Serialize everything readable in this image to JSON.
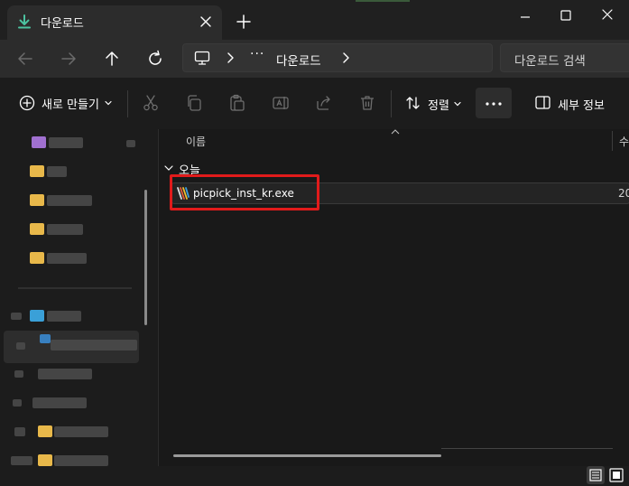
{
  "tab": {
    "title": "다운로드",
    "icon": "download-icon"
  },
  "address": {
    "overflow": "···",
    "current": "다운로드"
  },
  "search": {
    "placeholder": "다운로드 검색"
  },
  "toolbar": {
    "new_label": "새로 만들기",
    "sort_label": "정렬",
    "details_label": "세부 정보"
  },
  "columns": {
    "name": "이름",
    "next": "수"
  },
  "group": {
    "label": "오늘"
  },
  "file": {
    "name": "picpick_inst_kr.exe",
    "meta": "20"
  },
  "colors": {
    "accent": "#4cc2a0",
    "highlight": "#e11b1b",
    "folder": "#e8b84a"
  }
}
